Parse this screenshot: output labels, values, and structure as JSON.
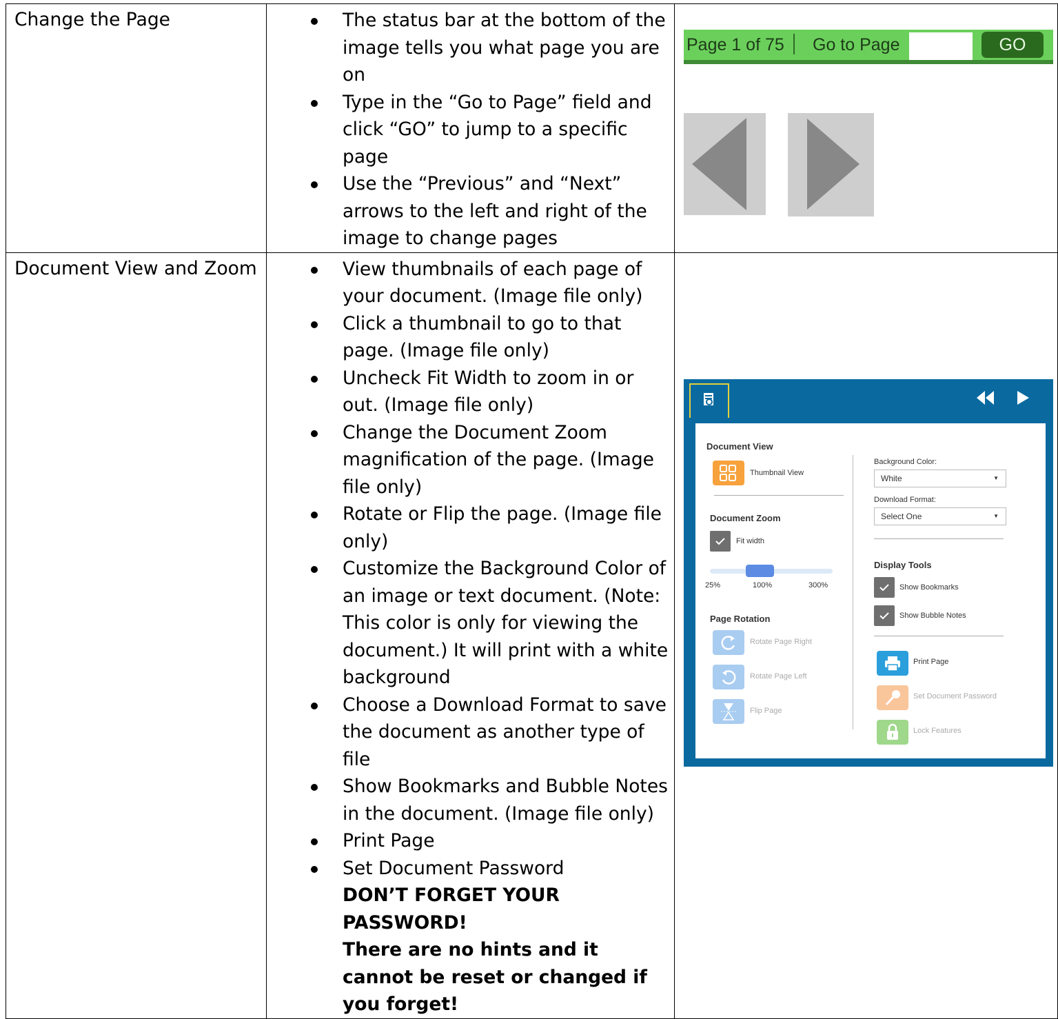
{
  "rows": [
    {
      "title": "Change the Page",
      "bullets": [
        "The status bar at the bottom of the image tells you what page you are on",
        "Type in the “Go to Page” field and click “GO” to jump to a specific page",
        "Use the “Previous” and “Next” arrows to the left and right of the image to change pages"
      ]
    },
    {
      "title": "Document View and Zoom",
      "bullets": [
        "View thumbnails of each page of your document. (Image file only)",
        "Click a thumbnail to go to that page. (Image file only)",
        "Uncheck Fit Width to zoom in or out. (Image file only)",
        "Change the Document Zoom magnification of the page. (Image file only)",
        "Rotate or Flip the page. (Image file only)",
        "Customize the Background Color of an image or text document. (Note: This color is only for viewing the document.) It will print with a white background",
        "Choose a Download Format to save the document as another type of file",
        "Show Bookmarks and Bubble Notes in the document. (Image file only)",
        "Print Page",
        "Set Document Password"
      ],
      "warning_1": "DON’T FORGET YOUR PASSWORD!",
      "warning_2": "There are no hints and it cannot be reset or changed if you forget!"
    }
  ],
  "status_bar": {
    "page_text": "Page 1 of 75",
    "goto_label": "Go to Page",
    "goto_value": "",
    "go_button": "GO",
    "color": "#6bd05b"
  },
  "panel": {
    "document_view": "Document View",
    "thumbnail_view": "Thumbnail View",
    "document_zoom": "Document Zoom",
    "fit_width": "Fit width",
    "zoom_ticks": [
      "25%",
      "100%",
      "300%"
    ],
    "zoom_value_percent": 100,
    "page_rotation": "Page Rotation",
    "rotate_right": "Rotate Page Right",
    "rotate_left": "Rotate Page Left",
    "flip_page": "Flip Page",
    "background_color_label": "Background Color:",
    "background_color_value": "White",
    "download_format_label": "Download Format:",
    "download_format_value": "Select One",
    "display_tools": "Display Tools",
    "show_bookmarks": "Show Bookmarks",
    "show_bubble_notes": "Show Bubble Notes",
    "print_page": "Print Page",
    "set_password": "Set Document Password",
    "lock_features": "Lock Features",
    "colors": {
      "header": "#0a6aa0",
      "thumb": "#f7a23c",
      "rotate": "#a9ccf1",
      "print": "#2a9fdc",
      "password": "#f9c59a",
      "lock": "#9fd88b"
    }
  }
}
